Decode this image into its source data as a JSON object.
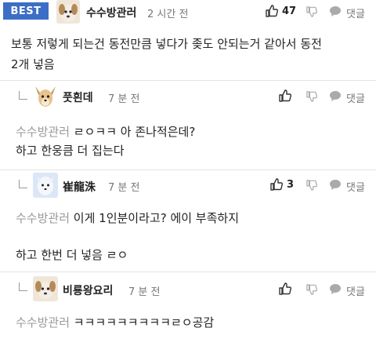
{
  "best_comment": {
    "badge": "BEST",
    "nickname": "수수방관러",
    "time": "2 시간 전",
    "like_count": "47",
    "reply_label": "댓글",
    "text_line1": "보통 저렇게 되는건 동전만큼 넣다가 좆도 안되는거 같아서 동전",
    "text_line2": "2개 넣음"
  },
  "replies": [
    {
      "nickname": "풋흰데",
      "time": "7 분 전",
      "like_count": "",
      "reply_label": "댓글",
      "mention": "수수방관러",
      "line1": "ㄹㅇㅋㅋ 아 존나적은데?",
      "line2": "하고 한웅큼 더 집는다"
    },
    {
      "nickname": "崔龍洙",
      "time": "7 분 전",
      "like_count": "3",
      "reply_label": "댓글",
      "mention": "수수방관러",
      "line1": "이게 1인분이라고? 에이 부족하지",
      "line2": "하고 한번 더 넣음 ㄹㅇ"
    },
    {
      "nickname": "비룡왕요리",
      "time": "7 분 전",
      "like_count": "",
      "reply_label": "댓글",
      "mention": "수수방관러",
      "line1": "ㅋㅋㅋㅋㅋㅋㅋㅋㅋㄹㅇ공감",
      "line2": ""
    }
  ],
  "colors": {
    "badge": "#3d6ec6",
    "mention": "#999999",
    "icon": "#333333",
    "icon_light": "#aaaaaa"
  }
}
